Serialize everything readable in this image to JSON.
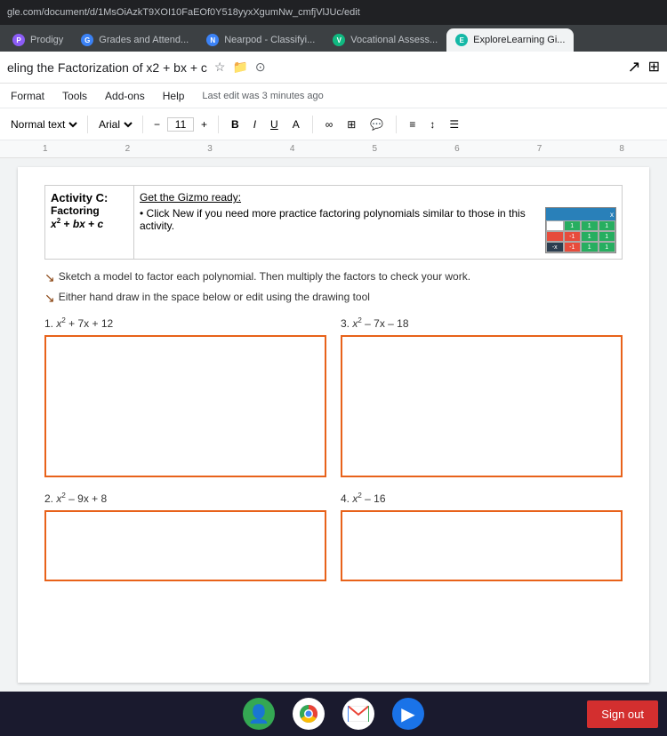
{
  "browser": {
    "address": "gle.com/document/d/1MsOiAzkT9XOI10FaEOf0Y518yyxXgumNw_cmfjVlJUc/edit",
    "tabs": [
      {
        "label": "Prodigy",
        "color": "purple",
        "icon": "P"
      },
      {
        "label": "Grades and Attend...",
        "color": "blue",
        "icon": "G"
      },
      {
        "label": "Nearpod - Classifyi...",
        "color": "blue",
        "icon": "N"
      },
      {
        "label": "Vocational Assess...",
        "color": "green",
        "icon": "V"
      },
      {
        "label": "ExploreLearning Gi...",
        "color": "teal",
        "icon": "E"
      }
    ]
  },
  "docs": {
    "title": "eling the Factorization of x2 + bx + c",
    "last_edit": "Last edit was 3 minutes ago",
    "menu": [
      "Format",
      "Tools",
      "Add-ons",
      "Help"
    ],
    "toolbar": {
      "style": "Normal text",
      "font": "Arial",
      "size": "11",
      "bold": "B",
      "italic": "I",
      "underline": "U"
    }
  },
  "content": {
    "activity_label": "Activity C:",
    "activity_subtitle": "Factoring",
    "activity_equation": "x² + bx + c",
    "gizmo_ready": "Get the Gizmo ready:",
    "gizmo_instruction": "Click New if you need more practice factoring polynomials similar to those in this activity.",
    "instruction1": "Sketch a model to factor each polynomial. Then multiply the factors to check your work.",
    "instruction2": "Either hand draw in the space below or edit using the drawing tool",
    "problems": [
      {
        "number": "1.",
        "label": "x² + 7x + 12",
        "size": "large"
      },
      {
        "number": "3.",
        "label": "x² – 7x – 18",
        "size": "large"
      },
      {
        "number": "2.",
        "label": "x² – 9x + 8",
        "size": "small"
      },
      {
        "number": "4.",
        "label": "x² – 16",
        "size": "small"
      }
    ]
  },
  "taskbar": {
    "sign_out": "Sign out"
  },
  "ruler": {
    "marks": [
      "1",
      "2",
      "3",
      "4",
      "5",
      "6",
      "7",
      "8"
    ]
  }
}
